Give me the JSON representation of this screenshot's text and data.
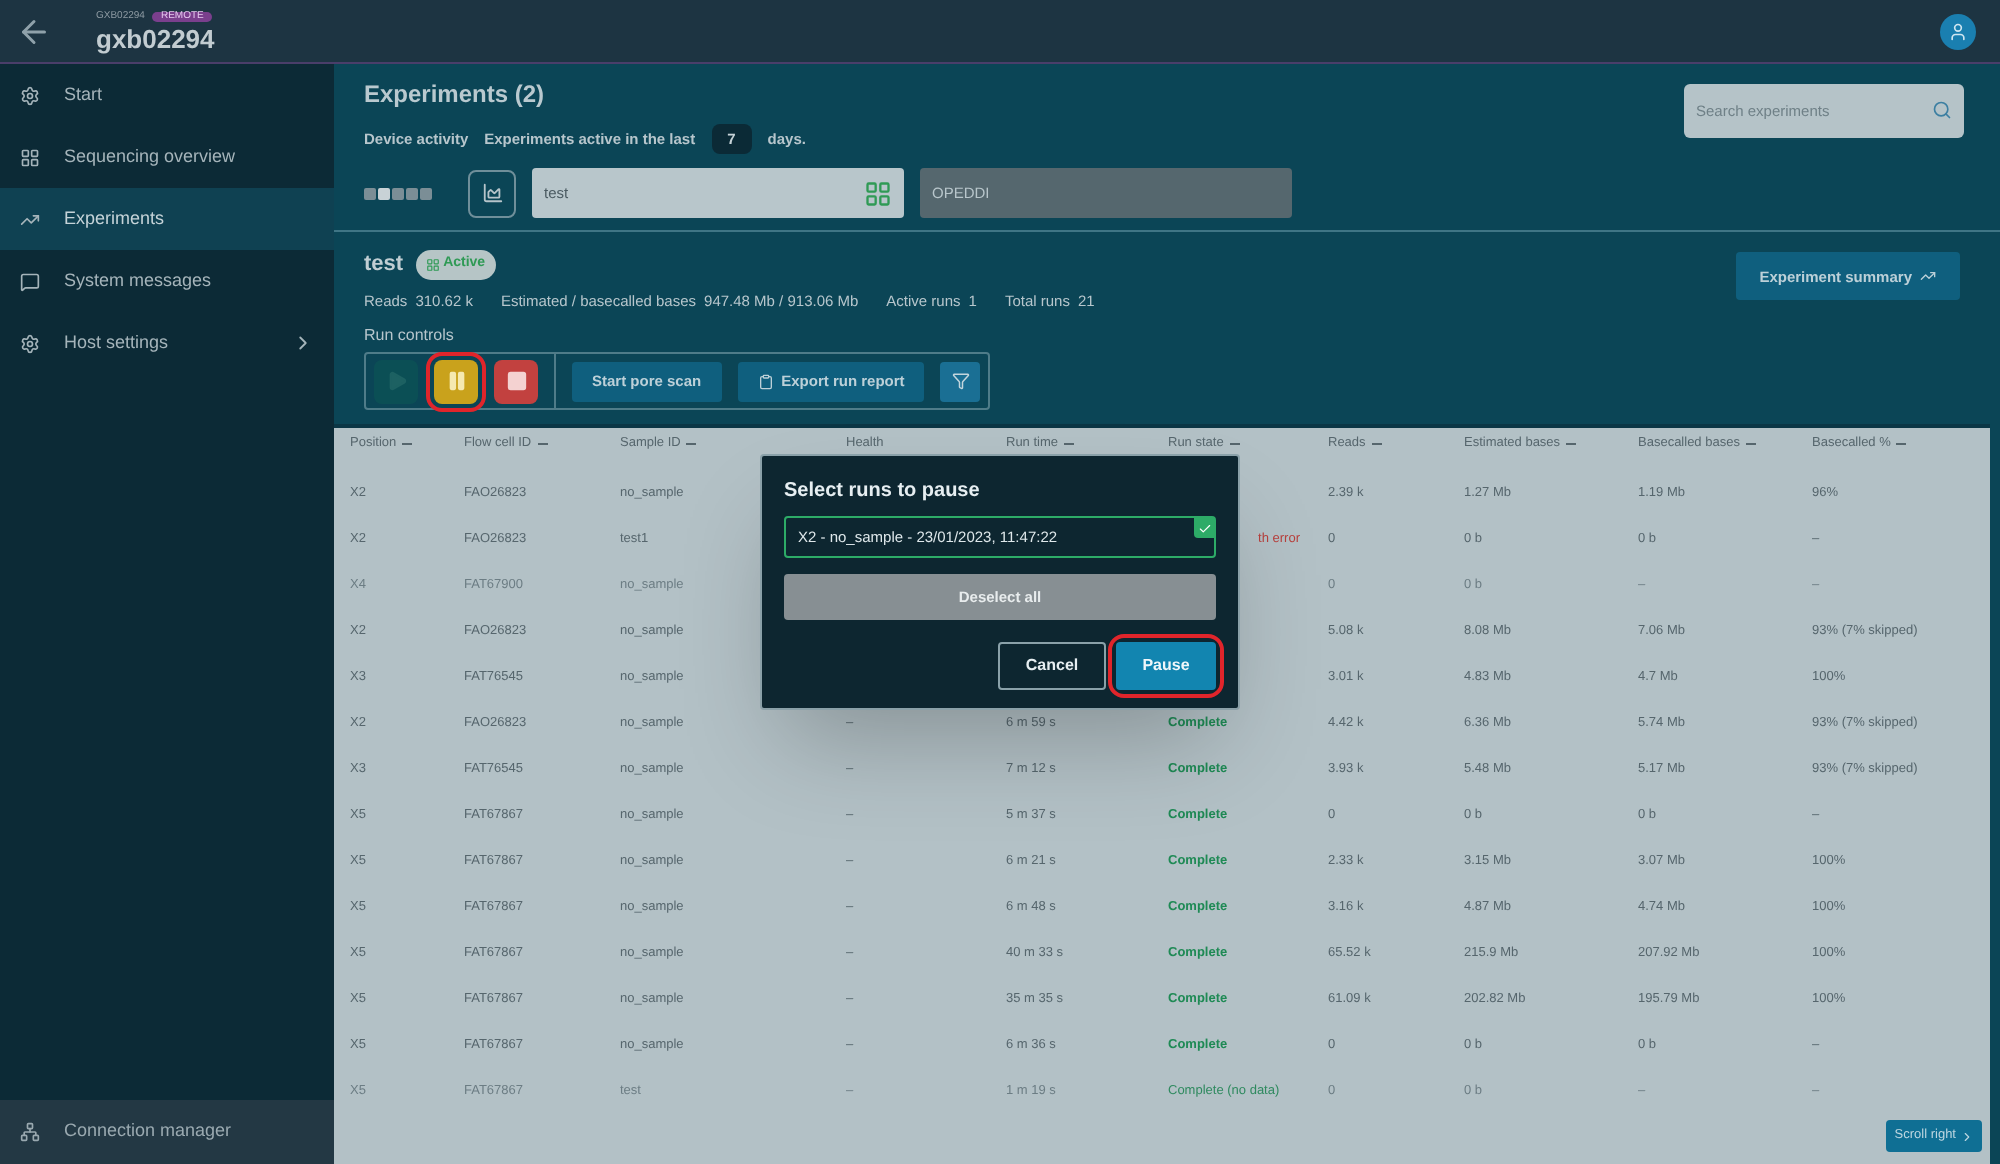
{
  "header": {
    "device_code": "GXB02294",
    "badge": "REMOTE",
    "device_name": "gxb02294"
  },
  "sidebar": {
    "items": [
      {
        "label": "Start",
        "selected": false,
        "has_submenu": false
      },
      {
        "label": "Sequencing overview",
        "selected": false,
        "has_submenu": false
      },
      {
        "label": "Experiments",
        "selected": true,
        "has_submenu": false
      },
      {
        "label": "System messages",
        "selected": false,
        "has_submenu": false
      },
      {
        "label": "Host settings",
        "selected": false,
        "has_submenu": true
      }
    ],
    "footer": "Connection manager"
  },
  "experiments": {
    "title": "Experiments (2)",
    "device_activity": "Device activity",
    "active_prefix": "Experiments active in the last",
    "days_value": "7",
    "days_suffix": "days.",
    "search": {
      "placeholder": "Search experiments"
    },
    "pages": [
      {
        "selected": false
      },
      {
        "selected": true
      },
      {
        "selected": false
      },
      {
        "selected": false
      },
      {
        "selected": false
      }
    ],
    "cards": [
      {
        "name": "test",
        "selected": true
      },
      {
        "name": "OPEDDI",
        "selected": false
      }
    ]
  },
  "experiment": {
    "name": "test",
    "status": "Active",
    "stats": [
      {
        "label": "Reads",
        "value": "310.62 k"
      },
      {
        "label": "Estimated / basecalled bases",
        "value": "947.48 Mb / 913.06 Mb"
      },
      {
        "label": "Active runs",
        "value": "1"
      },
      {
        "label": "Total runs",
        "value": "21"
      }
    ],
    "summary_button": "Experiment summary",
    "run_controls_label": "Run controls",
    "controls": [
      {
        "kind": "play",
        "disabled": true,
        "highlighted": false
      },
      {
        "kind": "pause",
        "disabled": false,
        "highlighted": true
      },
      {
        "kind": "stop",
        "disabled": false,
        "highlighted": false
      }
    ],
    "actions": [
      {
        "label": "Start pore scan",
        "icon": false
      },
      {
        "label": "Export run report",
        "icon": true
      }
    ]
  },
  "table": {
    "columns": [
      {
        "label": "Position",
        "sortable": true
      },
      {
        "label": "Flow cell ID",
        "sortable": true
      },
      {
        "label": "Sample ID",
        "sortable": true
      },
      {
        "label": "Health",
        "sortable": false
      },
      {
        "label": "Run time",
        "sortable": true
      },
      {
        "label": "Run state",
        "sortable": true
      },
      {
        "label": "Reads",
        "sortable": true
      },
      {
        "label": "Estimated bases",
        "sortable": true
      },
      {
        "label": "Basecalled bases",
        "sortable": true
      },
      {
        "label": "Basecalled %",
        "sortable": true
      }
    ],
    "rows": [
      {
        "faded": false,
        "cells": [
          "X2",
          "FAO26823",
          "no_sample",
          null,
          null,
          null,
          "2.39 k",
          "1.27 Mb",
          "1.19 Mb",
          "96%"
        ]
      },
      {
        "faded": false,
        "cells": [
          "X2",
          "FAO26823",
          "test1",
          null,
          null,
          {
            "text": "th error",
            "kind": "error"
          },
          "0",
          "0 b",
          "0 b",
          "–"
        ]
      },
      {
        "faded": true,
        "cells": [
          "X4",
          "FAT67900",
          "no_sample",
          null,
          null,
          null,
          "0",
          "0 b",
          "–",
          "–"
        ]
      },
      {
        "faded": false,
        "cells": [
          "X2",
          "FAO26823",
          "no_sample",
          null,
          null,
          null,
          "5.08 k",
          "8.08 Mb",
          "7.06 Mb",
          "93% (7% skipped)"
        ]
      },
      {
        "faded": false,
        "cells": [
          "X3",
          "FAT76545",
          "no_sample",
          null,
          null,
          null,
          "3.01 k",
          "4.83 Mb",
          "4.7 Mb",
          "100%"
        ]
      },
      {
        "faded": false,
        "cells": [
          "X2",
          "FAO26823",
          "no_sample",
          "–",
          "6 m 59 s",
          {
            "text": "Complete",
            "kind": "complete"
          },
          "4.42 k",
          "6.36 Mb",
          "5.74 Mb",
          "93% (7% skipped)"
        ]
      },
      {
        "faded": false,
        "cells": [
          "X3",
          "FAT76545",
          "no_sample",
          "–",
          "7 m 12 s",
          {
            "text": "Complete",
            "kind": "complete"
          },
          "3.93 k",
          "5.48 Mb",
          "5.17 Mb",
          "93% (7% skipped)"
        ]
      },
      {
        "faded": false,
        "cells": [
          "X5",
          "FAT67867",
          "no_sample",
          "–",
          "5 m 37 s",
          {
            "text": "Complete",
            "kind": "complete"
          },
          "0",
          "0 b",
          "0 b",
          "–"
        ]
      },
      {
        "faded": false,
        "cells": [
          "X5",
          "FAT67867",
          "no_sample",
          "–",
          "6 m 21 s",
          {
            "text": "Complete",
            "kind": "complete"
          },
          "2.33 k",
          "3.15 Mb",
          "3.07 Mb",
          "100%"
        ]
      },
      {
        "faded": false,
        "cells": [
          "X5",
          "FAT67867",
          "no_sample",
          "–",
          "6 m 48 s",
          {
            "text": "Complete",
            "kind": "complete"
          },
          "3.16 k",
          "4.87 Mb",
          "4.74 Mb",
          "100%"
        ]
      },
      {
        "faded": false,
        "cells": [
          "X5",
          "FAT67867",
          "no_sample",
          "–",
          "40 m 33 s",
          {
            "text": "Complete",
            "kind": "complete"
          },
          "65.52 k",
          "215.9 Mb",
          "207.92 Mb",
          "100%"
        ]
      },
      {
        "faded": false,
        "cells": [
          "X5",
          "FAT67867",
          "no_sample",
          "–",
          "35 m 35 s",
          {
            "text": "Complete",
            "kind": "complete"
          },
          "61.09 k",
          "202.82 Mb",
          "195.79 Mb",
          "100%"
        ]
      },
      {
        "faded": false,
        "cells": [
          "X5",
          "FAT67867",
          "no_sample",
          "–",
          "6 m 36 s",
          {
            "text": "Complete",
            "kind": "complete"
          },
          "0",
          "0 b",
          "0 b",
          "–"
        ]
      },
      {
        "faded": true,
        "cells": [
          "X5",
          "FAT67867",
          "test",
          "–",
          "1 m 19 s",
          {
            "text": "Complete (no data)",
            "kind": "complete"
          },
          "0",
          "0 b",
          "–",
          "–"
        ]
      }
    ],
    "scroll_button": "Scroll right"
  },
  "dialog": {
    "title": "Select runs to pause",
    "runs": [
      {
        "label": "X2 - no_sample - 23/01/2023, 11:47:22",
        "checked": true
      }
    ],
    "deselect": "Deselect all",
    "cancel": "Cancel",
    "confirm": {
      "label": "Pause",
      "highlighted": true
    }
  }
}
